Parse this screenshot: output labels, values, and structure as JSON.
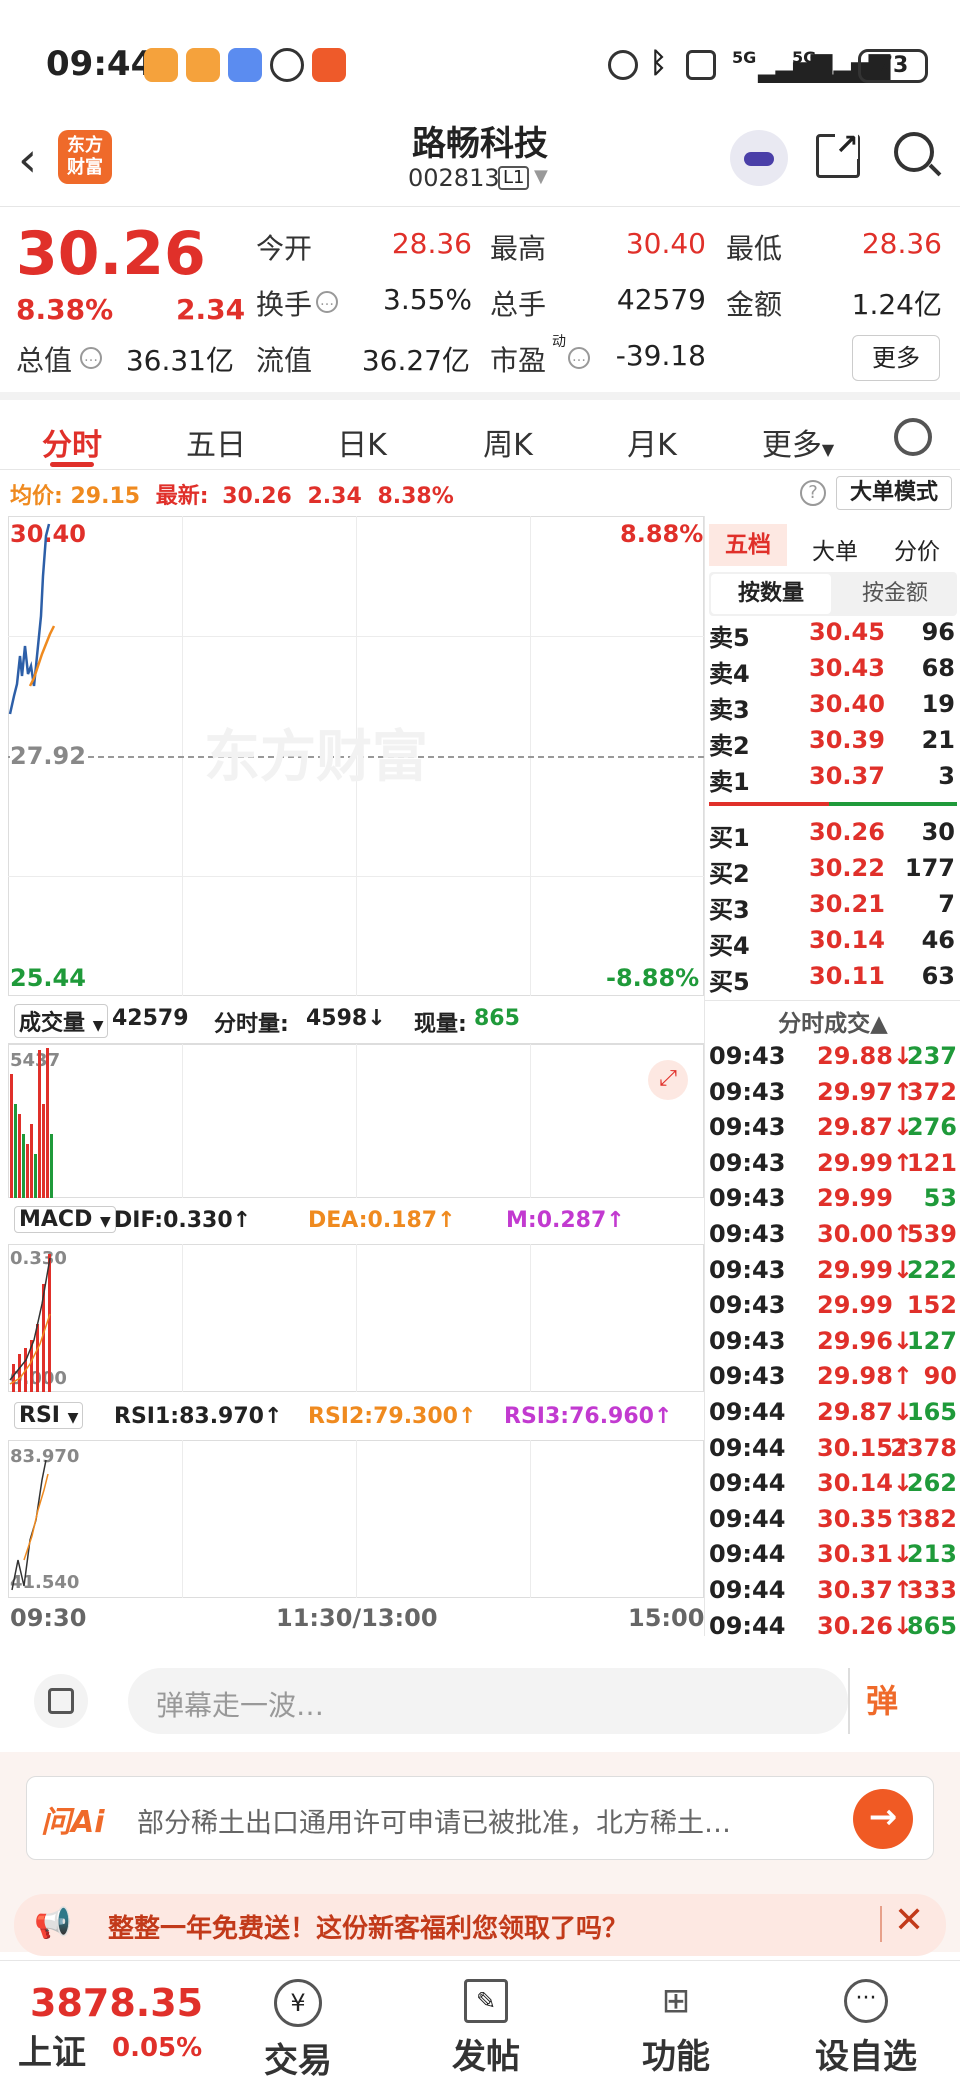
{
  "status": {
    "time": "09:44",
    "battery": "73",
    "signal1": "5G",
    "signal2": "5G"
  },
  "header": {
    "name": "路畅科技",
    "code": "002813",
    "level": "L1",
    "logo_line1": "东方",
    "logo_line2": "财富"
  },
  "quote": {
    "price": "30.26",
    "change_pct": "8.38%",
    "change": "2.34",
    "open_label": "今开",
    "open": "28.36",
    "high_label": "最高",
    "high": "30.40",
    "low_label": "最低",
    "low": "28.36",
    "turnover_label": "换手",
    "turnover": "3.55%",
    "volume_label": "总手",
    "volume": "42579",
    "amount_label": "金额",
    "amount": "1.24亿",
    "mktcap_label": "总值",
    "mktcap": "36.31亿",
    "float_label": "流值",
    "float": "36.27亿",
    "pe_label": "市盈",
    "pe_sup": "动",
    "pe": "-39.18",
    "more": "更多"
  },
  "tabs": [
    "分时",
    "五日",
    "日K",
    "周K",
    "月K",
    "更多"
  ],
  "avgline": {
    "avg_label": "均价:",
    "avg": "29.15",
    "latest_label": "最新:",
    "latest": "30.26",
    "chg": "2.34",
    "pct": "8.38%",
    "mode": "大单模式"
  },
  "chart": {
    "price_high": "30.40",
    "pct_high": "8.88%",
    "price_mid": "27.92",
    "price_low": "25.44",
    "pct_low": "-8.88%",
    "watermark": "东方财富",
    "vol_sel": "成交量",
    "vol_total": "42579",
    "vol_period_label": "分时量:",
    "vol_period": "4598↓",
    "vol_now_label": "现量:",
    "vol_now": "865",
    "vol_max": "5437",
    "macd_sel": "MACD",
    "dif": "DIF:0.330↑",
    "dea": "DEA:0.187↑",
    "m": "M:0.287↑",
    "macd_top": "0.330",
    "macd_bottom": "0.000",
    "rsi_sel": "RSI",
    "rsi1": "RSI1:83.970↑",
    "rsi2": "RSI2:79.300↑",
    "rsi3": "RSI3:76.960↑",
    "rsi_top": "83.970",
    "rsi_bottom": "41.540",
    "t_start": "09:30",
    "t_mid": "11:30/13:00",
    "t_end": "15:00"
  },
  "book": {
    "tabs": [
      "五档",
      "大单",
      "分价"
    ],
    "sub_tabs": [
      "按数量",
      "按金额"
    ],
    "asks": [
      {
        "label": "卖5",
        "price": "30.45",
        "qty": "96"
      },
      {
        "label": "卖4",
        "price": "30.43",
        "qty": "68"
      },
      {
        "label": "卖3",
        "price": "30.40",
        "qty": "19"
      },
      {
        "label": "卖2",
        "price": "30.39",
        "qty": "21"
      },
      {
        "label": "卖1",
        "price": "30.37",
        "qty": "3"
      }
    ],
    "bids": [
      {
        "label": "买1",
        "price": "30.26",
        "qty": "30"
      },
      {
        "label": "买2",
        "price": "30.22",
        "qty": "177"
      },
      {
        "label": "买3",
        "price": "30.21",
        "qty": "7"
      },
      {
        "label": "买4",
        "price": "30.14",
        "qty": "46"
      },
      {
        "label": "买5",
        "price": "30.11",
        "qty": "63"
      }
    ],
    "trades_title": "分时成交▲",
    "trades": [
      {
        "time": "09:43",
        "price": "29.88↓",
        "qty": "237",
        "pc": "red",
        "qc": "green"
      },
      {
        "time": "09:43",
        "price": "29.97↑",
        "qty": "372",
        "pc": "red",
        "qc": "red"
      },
      {
        "time": "09:43",
        "price": "29.87↓",
        "qty": "276",
        "pc": "red",
        "qc": "green"
      },
      {
        "time": "09:43",
        "price": "29.99↑",
        "qty": "121",
        "pc": "red",
        "qc": "red"
      },
      {
        "time": "09:43",
        "price": "29.99",
        "qty": "53",
        "pc": "red",
        "qc": "green"
      },
      {
        "time": "09:43",
        "price": "30.00↑",
        "qty": "539",
        "pc": "red",
        "qc": "red"
      },
      {
        "time": "09:43",
        "price": "29.99↓",
        "qty": "222",
        "pc": "red",
        "qc": "green"
      },
      {
        "time": "09:43",
        "price": "29.99",
        "qty": "152",
        "pc": "red",
        "qc": "red"
      },
      {
        "time": "09:43",
        "price": "29.96↓",
        "qty": "127",
        "pc": "red",
        "qc": "green"
      },
      {
        "time": "09:43",
        "price": "29.98↑",
        "qty": "90",
        "pc": "red",
        "qc": "red"
      },
      {
        "time": "09:44",
        "price": "29.87↓",
        "qty": "165",
        "pc": "red",
        "qc": "green"
      },
      {
        "time": "09:44",
        "price": "30.15↑",
        "qty": "2378",
        "pc": "red",
        "qc": "red"
      },
      {
        "time": "09:44",
        "price": "30.14↓",
        "qty": "262",
        "pc": "red",
        "qc": "green"
      },
      {
        "time": "09:44",
        "price": "30.35↑",
        "qty": "382",
        "pc": "red",
        "qc": "red"
      },
      {
        "time": "09:44",
        "price": "30.31↓",
        "qty": "213",
        "pc": "red",
        "qc": "green"
      },
      {
        "time": "09:44",
        "price": "30.37↑",
        "qty": "333",
        "pc": "red",
        "qc": "red"
      },
      {
        "time": "09:44",
        "price": "30.26↓",
        "qty": "865",
        "pc": "red",
        "qc": "green"
      }
    ]
  },
  "comment": {
    "placeholder": "弹幕走一波…",
    "danmaku": "弹"
  },
  "ai": {
    "logo": "问Ai",
    "text": "部分稀土出口通用许可申请已被批准，北方稀土…",
    "promo": "整整一年免费送！这份新客福利您领取了吗？"
  },
  "nav": {
    "index_value": "3878.35",
    "index_name": "上证",
    "index_pct": "0.05%",
    "trade": "交易",
    "post": "发帖",
    "func": "功能",
    "watch": "设自选",
    "trade_glyph": "¥"
  },
  "colors": {
    "up": "#e0302a",
    "down": "#1f9a3a",
    "avg": "#ef8a1f",
    "accent": "#e0302a"
  }
}
